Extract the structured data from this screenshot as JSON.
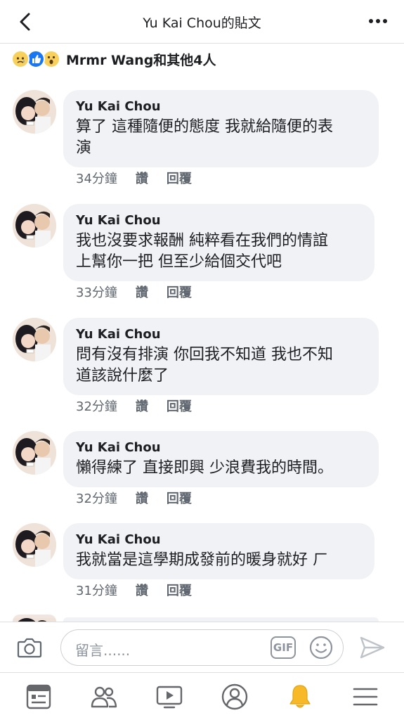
{
  "header": {
    "title": "Yu Kai Chou的貼文",
    "back_icon": "chevron-left-icon",
    "more_icon": "more-horizontal-icon"
  },
  "reactions": {
    "icons": [
      "sad-reaction-icon",
      "like-reaction-icon",
      "wow-reaction-icon"
    ],
    "summary": "Mrmr Wang和其他4人"
  },
  "comments": [
    {
      "author": "Yu Kai Chou",
      "lines": [
        "算了 這種隨便的態度 我就給隨便的表",
        "演"
      ],
      "time": "34分鐘",
      "like_label": "讚",
      "reply_label": "回覆"
    },
    {
      "author": "Yu Kai Chou",
      "lines": [
        "我也沒要求報酬 純粹看在我們的情誼",
        "上幫你一把 但至少給個交代吧"
      ],
      "time": "33分鐘",
      "like_label": "讚",
      "reply_label": "回覆"
    },
    {
      "author": "Yu Kai Chou",
      "lines": [
        "問有沒有排演 你回我不知道 我也不知",
        "道該說什麼了"
      ],
      "time": "32分鐘",
      "like_label": "讚",
      "reply_label": "回覆"
    },
    {
      "author": "Yu Kai Chou",
      "lines": [
        "懶得練了 直接即興 少浪費我的時間。"
      ],
      "time": "32分鐘",
      "like_label": "讚",
      "reply_label": "回覆"
    },
    {
      "author": "Yu Kai Chou",
      "lines": [
        "我就當是這學期成發前的暖身就好 ㄏ"
      ],
      "time": "31分鐘",
      "like_label": "讚",
      "reply_label": "回覆"
    }
  ],
  "composer": {
    "placeholder": "留言......",
    "gif_label": "GIF",
    "camera_icon": "camera-icon",
    "emoji_icon": "emoji-icon",
    "send_icon": "send-icon"
  },
  "bottom_nav": {
    "items": [
      "news-feed-icon",
      "groups-icon",
      "watch-icon",
      "profile-icon",
      "notifications-bell-icon",
      "menu-icon"
    ],
    "active_color": "#f7b928",
    "inactive_color": "#65676b"
  }
}
